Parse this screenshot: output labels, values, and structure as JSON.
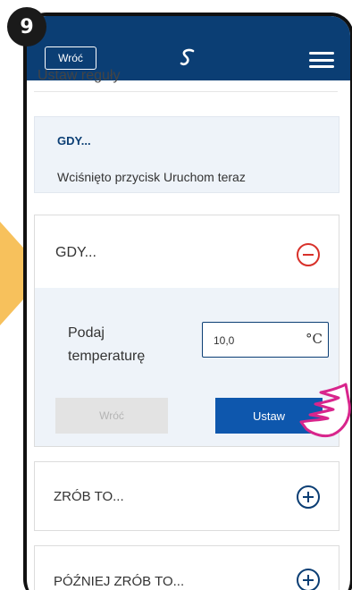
{
  "step_number": "9",
  "header": {
    "back_label": "Wróć",
    "logo_icon": "s-logo-icon",
    "menu_icon": "hamburger-icon"
  },
  "page": {
    "subtitle": "Ustaw reguły"
  },
  "info_card": {
    "title": "GDY...",
    "text": "Wciśnięto przycisk Uruchom teraz"
  },
  "when_card": {
    "title": "GDY...",
    "temperature_label": "Podaj temperaturę",
    "temperature_value": "10,0",
    "temperature_unit": "°C",
    "back_button": "Wróć",
    "set_button": "Ustaw"
  },
  "do_card": {
    "title": "ZRÓB TO..."
  },
  "later_card": {
    "title": "PÓŹNIEJ ZRÓB TO..."
  },
  "colors": {
    "brand": "#0b3e74",
    "set_button": "#0e57ad",
    "remove": "#d8312a",
    "arrow": "#f7c15c",
    "hand": "#d8258c"
  }
}
